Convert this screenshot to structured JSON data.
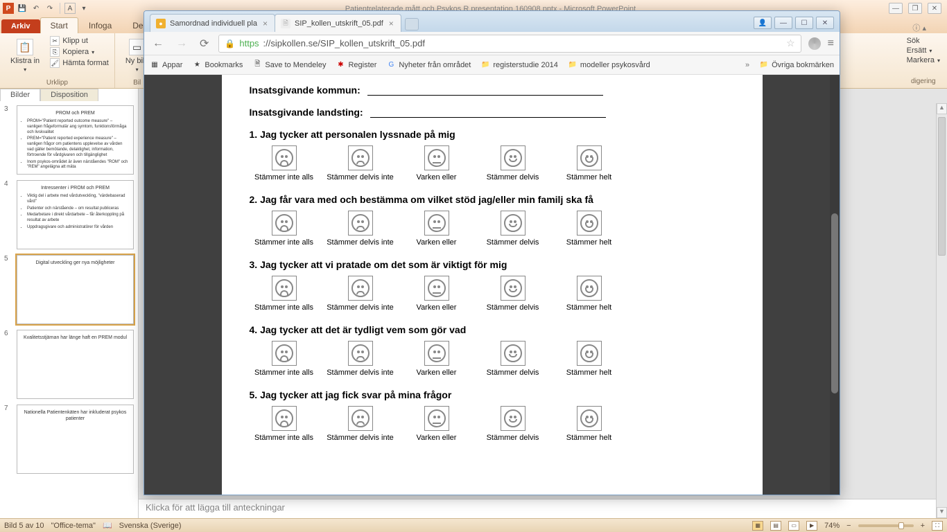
{
  "powerpoint": {
    "titlebar_doc": "Patientrelaterade mått och Psykos R presentation 160908.pptx  -  Microsoft PowerPoint",
    "qat": {
      "letter": "A"
    },
    "tabs": {
      "file": "Arkiv",
      "home": "Start",
      "insert": "Infoga",
      "design_prefix": "Des"
    },
    "ribbon": {
      "paste": "Klistra in",
      "cut": "Klipp ut",
      "copy": "Kopiera",
      "format_painter": "Hämta format",
      "clipboard_group": "Urklipp",
      "new_slide": "Ny bild",
      "slides_group": "Bil",
      "find": "Sök",
      "replace": "Ersätt",
      "select": "Markera",
      "editing_group": "digering"
    },
    "thumb_tabs": {
      "slides": "Bilder",
      "outline": "Disposition"
    },
    "slides": [
      {
        "num": "3",
        "title": "PROM och PREM",
        "bullets": [
          "PROM=\"Patient reported outcome measure\" – vanligen frågeformulär ang symtom, funktionsförmåga och livskvalitet",
          "PREM=\"Patient reported experience measure\" – vanligen frågor om patientens upplevelse av vården vad gäller bemötande, delaktighet, information, förtroende för vårdgivaren och tillgänglighet",
          "Inom psykos-området är även närståendes \"ROM\" och \"REM\" angelägna att mäta"
        ]
      },
      {
        "num": "4",
        "title": "Intressenter i PROM och PREM",
        "bullets": [
          "Viktig del i arbete med vårdutveckling, \"värdebaserad vård\"",
          "Patienter och närstående – om resultat publiceras",
          "Medarbetare i direkt vårdarbete – får återkoppling på resultat av arbete",
          "Uppdragsgivare och administratörer för vården"
        ]
      },
      {
        "num": "5",
        "title": "Digital utveckling ger nya möjligheter",
        "bullets": []
      },
      {
        "num": "6",
        "title": "Kvalitetsstjärnan har länge haft en PREM modul",
        "bullets": []
      },
      {
        "num": "7",
        "title": "Nationella Patientenkäten har inkluderat psykos patienter",
        "bullets": []
      }
    ],
    "selected_slide_index": 2,
    "notes_placeholder": "Klicka för att lägga till anteckningar",
    "status": {
      "slide_of": "Bild 5 av 10",
      "theme": "\"Office-tema\"",
      "lang": "Svenska (Sverige)",
      "zoom": "74%"
    }
  },
  "chrome": {
    "tabs": [
      {
        "title": "Samordnad individuell pla",
        "active": false,
        "favicon": "orange"
      },
      {
        "title": "SIP_kollen_utskrift_05.pdf",
        "active": true,
        "favicon": "pdf"
      }
    ],
    "url": {
      "https": "https",
      "host_path": "://sipkollen.se/SIP_kollen_utskrift_05.pdf"
    },
    "bookmarks": {
      "apps": "Appar",
      "items": [
        "Bookmarks",
        "Save to Mendeley",
        "Register",
        "Nyheter från området",
        "registerstudie 2014",
        "modeller psykosvård"
      ],
      "overflow": "»",
      "right": "Övriga bokmärken"
    }
  },
  "pdf": {
    "field_kommun": "Insatsgivande kommun:",
    "field_landsting": "Insatsgivande landsting:",
    "opt_labels": [
      "Stämmer inte alls",
      "Stämmer delvis inte",
      "Varken eller",
      "Stämmer delvis",
      "Stämmer helt"
    ],
    "questions": [
      "1. Jag tycker att personalen lyssnade på mig",
      "2. Jag får vara med och bestämma om vilket stöd jag/eller min familj ska få",
      "3. Jag tycker att vi pratade om det som är viktigt för mig",
      "4. Jag tycker att det är tydligt vem som gör vad",
      "5. Jag tycker att jag fick svar på mina frågor"
    ]
  }
}
